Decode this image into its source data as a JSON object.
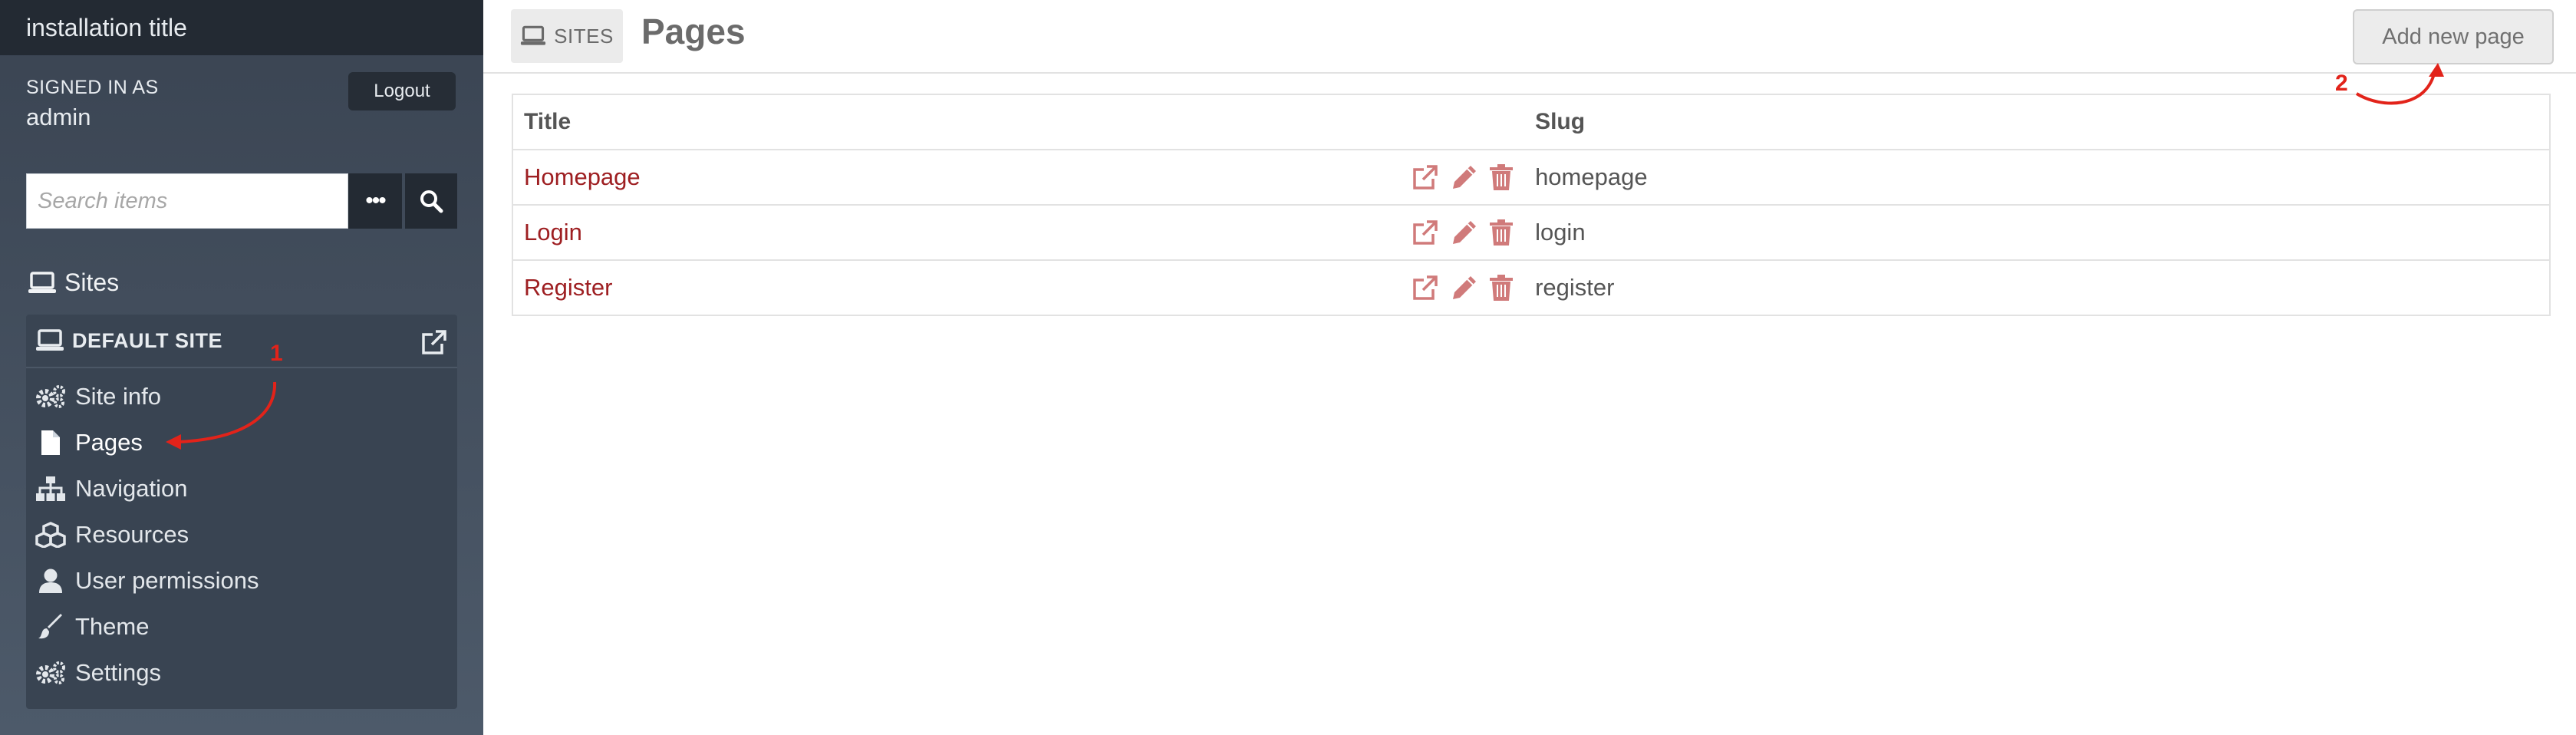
{
  "sidebar": {
    "installation_title": "installation title",
    "signed_in_label": "SIGNED IN AS",
    "username": "admin",
    "logout_label": "Logout",
    "search": {
      "placeholder": "Search items",
      "more_label": "•••"
    },
    "sites_heading": "Sites",
    "site": {
      "name": "DEFAULT SITE",
      "nav": [
        {
          "label": "Site info",
          "icon": "gears-icon"
        },
        {
          "label": "Pages",
          "icon": "file-icon",
          "active": true
        },
        {
          "label": "Navigation",
          "icon": "sitemap-icon"
        },
        {
          "label": "Resources",
          "icon": "cubes-icon"
        },
        {
          "label": "User permissions",
          "icon": "user-icon"
        },
        {
          "label": "Theme",
          "icon": "paint-brush-icon"
        },
        {
          "label": "Settings",
          "icon": "gears-icon"
        }
      ]
    }
  },
  "header": {
    "breadcrumb": "SITES",
    "title": "Pages",
    "add_button": "Add new page"
  },
  "table": {
    "columns": [
      "Title",
      "Slug"
    ],
    "rows": [
      {
        "title": "Homepage",
        "slug": "homepage"
      },
      {
        "title": "Login",
        "slug": "login"
      },
      {
        "title": "Register",
        "slug": "register"
      }
    ]
  },
  "annotations": {
    "step1": "1",
    "step2": "2"
  },
  "colors": {
    "sidebar_dark": "#232a33",
    "sidebar": "#3a4452",
    "link": "#9e1f22",
    "action_icon": "#d07a7a",
    "annotation": "#e2231a"
  }
}
